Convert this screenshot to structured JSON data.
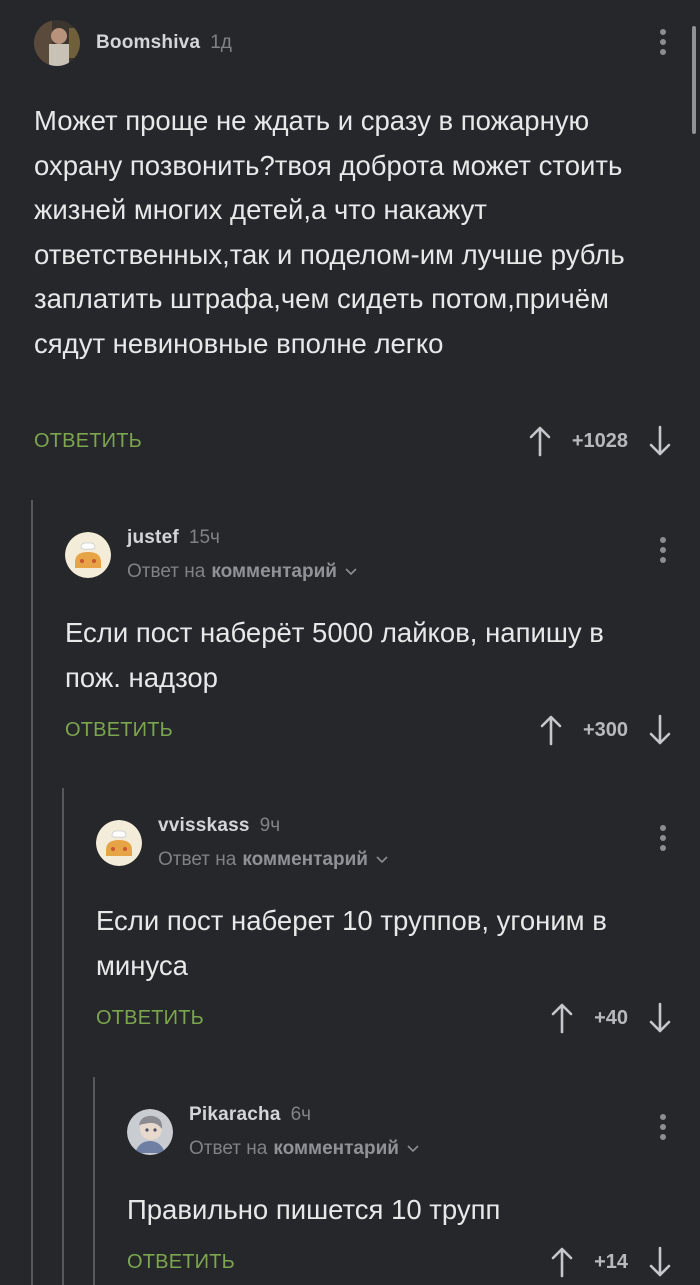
{
  "comments": [
    {
      "username": "Boomshiva",
      "time": "1д",
      "text": "Может проще не ждать и сразу в пожарную охрану позвонить?твоя доброта может стоить жизней многих детей,а что накажут ответственных,так и поделом-им лучше рубль заплатить штрафа,чем сидеть потом,причём сядут невиновные вполне легко",
      "reply_label": "ОТВЕТИТЬ",
      "score": "+1028"
    },
    {
      "username": "justef",
      "time": "15ч",
      "reply_to_prefix": "Ответ на",
      "reply_to_target": "комментарий",
      "text": "Если пост наберёт 5000 лайков, напишу в пож. надзор",
      "reply_label": "ОТВЕТИТЬ",
      "score": "+300"
    },
    {
      "username": "vvisskass",
      "time": "9ч",
      "reply_to_prefix": "Ответ на",
      "reply_to_target": "комментарий",
      "text": "Если пост наберет 10 труппов, угоним в минуса",
      "reply_label": "ОТВЕТИТЬ",
      "score": "+40"
    },
    {
      "username": "Pikaracha",
      "time": "6ч",
      "reply_to_prefix": "Ответ на",
      "reply_to_target": "комментарий",
      "text": "Правильно пишется 10 трупп",
      "reply_label": "ОТВЕТИТЬ",
      "score": "+14"
    }
  ],
  "colors": {
    "background": "#25272b",
    "reply_button": "#7ca64d",
    "thread_line": "#55585d"
  },
  "icons": [
    "more-vertical-icon",
    "upvote-arrow-icon",
    "downvote-arrow-icon",
    "chevron-down-icon"
  ]
}
